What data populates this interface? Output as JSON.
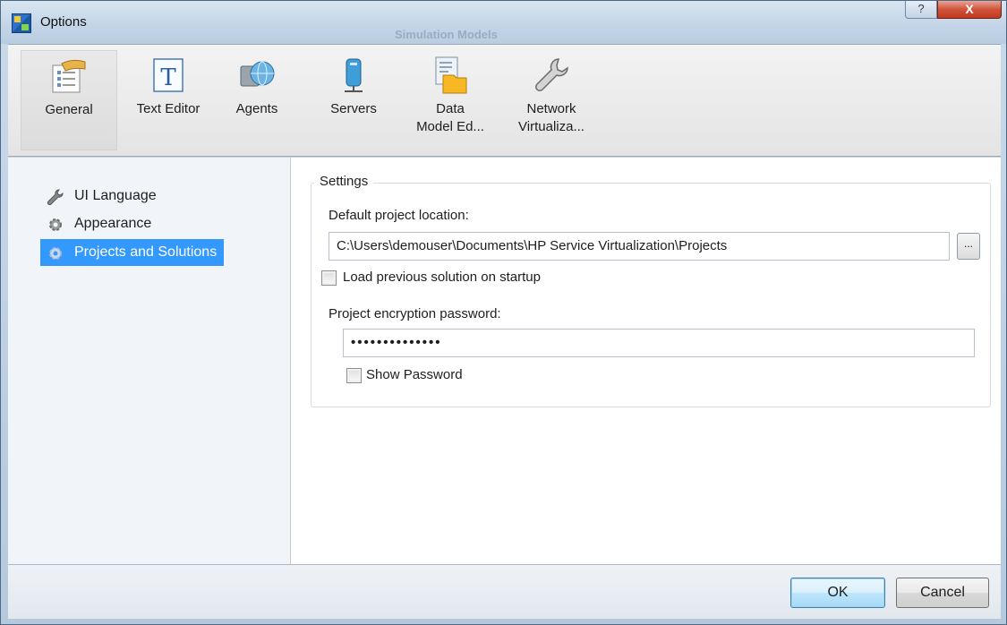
{
  "window": {
    "title": "Options",
    "background_title": "Simulation Models"
  },
  "titlebar": {
    "help_label": "?",
    "close_label": "X"
  },
  "toolbar": {
    "items": [
      {
        "label": "General",
        "icon": "general-settings-icon",
        "selected": true
      },
      {
        "label": "Text Editor",
        "icon": "text-editor-icon"
      },
      {
        "label": "Agents",
        "icon": "agents-icon"
      },
      {
        "label": "Servers",
        "icon": "servers-icon"
      },
      {
        "label": "Data\nModel Ed...",
        "line1": "Data",
        "line2": "Model Ed...",
        "icon": "data-model-editor-icon"
      },
      {
        "label": "Network\nVirtualiza...",
        "line1": "Network",
        "line2": "Virtualiza...",
        "icon": "wrench-icon"
      }
    ]
  },
  "sidebar": {
    "items": [
      {
        "label": "UI Language",
        "icon": "wrench-icon"
      },
      {
        "label": "Appearance",
        "icon": "gear-icon"
      },
      {
        "label": "Projects and Solutions",
        "icon": "gear-icon",
        "active": true
      }
    ]
  },
  "settings": {
    "group_title": "Settings",
    "default_location_label": "Default project location:",
    "default_location_value": "C:\\Users\\demouser\\Documents\\HP Service Virtualization\\Projects",
    "browse_label": "...",
    "load_previous_label": "Load previous solution on startup",
    "load_previous_checked": false,
    "encryption_label": "Project encryption password:",
    "encryption_value": "••••••••••••••",
    "show_password_label": "Show Password",
    "show_password_checked": false
  },
  "footer": {
    "ok_label": "OK",
    "cancel_label": "Cancel"
  },
  "colors": {
    "selection": "#3399ff",
    "close_button": "#c0391f"
  }
}
